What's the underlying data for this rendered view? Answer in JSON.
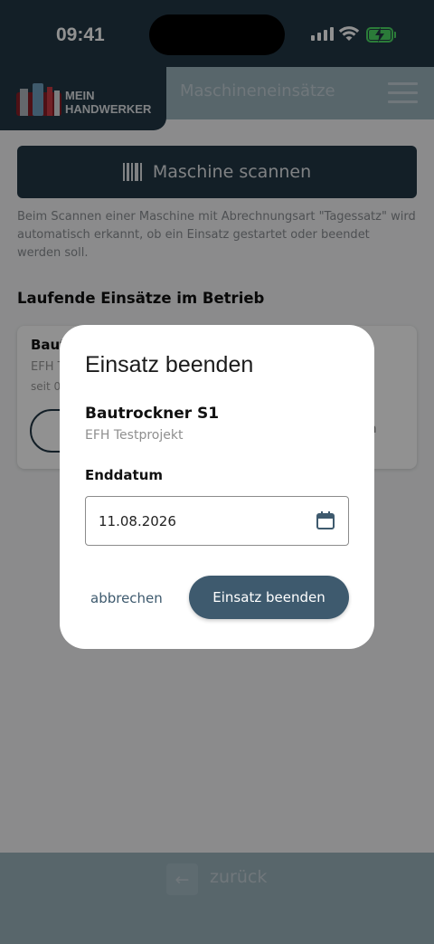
{
  "status_bar": {
    "time": "09:41"
  },
  "header": {
    "logo_line1": "MEIN",
    "logo_line2": "HANDWERKER",
    "title": "Maschineneinsätze"
  },
  "main": {
    "scan_button_label": "Maschine scannen",
    "info_text": "Beim Scannen einer Maschine mit Abrechnungsart \"Tagessatz\" wird automatisch erkannt, ob ein Einsatz gestartet oder beendet werden soll.",
    "section_title": "Laufende Einsätze im Betrieb",
    "card": {
      "title": "Bautrockner S1",
      "project": "EFH Testprojekt",
      "since": "seit 0",
      "right_text": "en"
    }
  },
  "bottom_bar": {
    "back_label": "zurück"
  },
  "dialog": {
    "title": "Einsatz beenden",
    "machine": "Bautrockner S1",
    "project": "EFH Testprojekt",
    "date_label": "Enddatum",
    "date_value": "11.08.2026",
    "cancel_label": "abbrechen",
    "confirm_label": "Einsatz beenden"
  },
  "colors": {
    "primary": "#233746",
    "accent": "#3e5a6e",
    "header_light": "#9bb3bd"
  }
}
